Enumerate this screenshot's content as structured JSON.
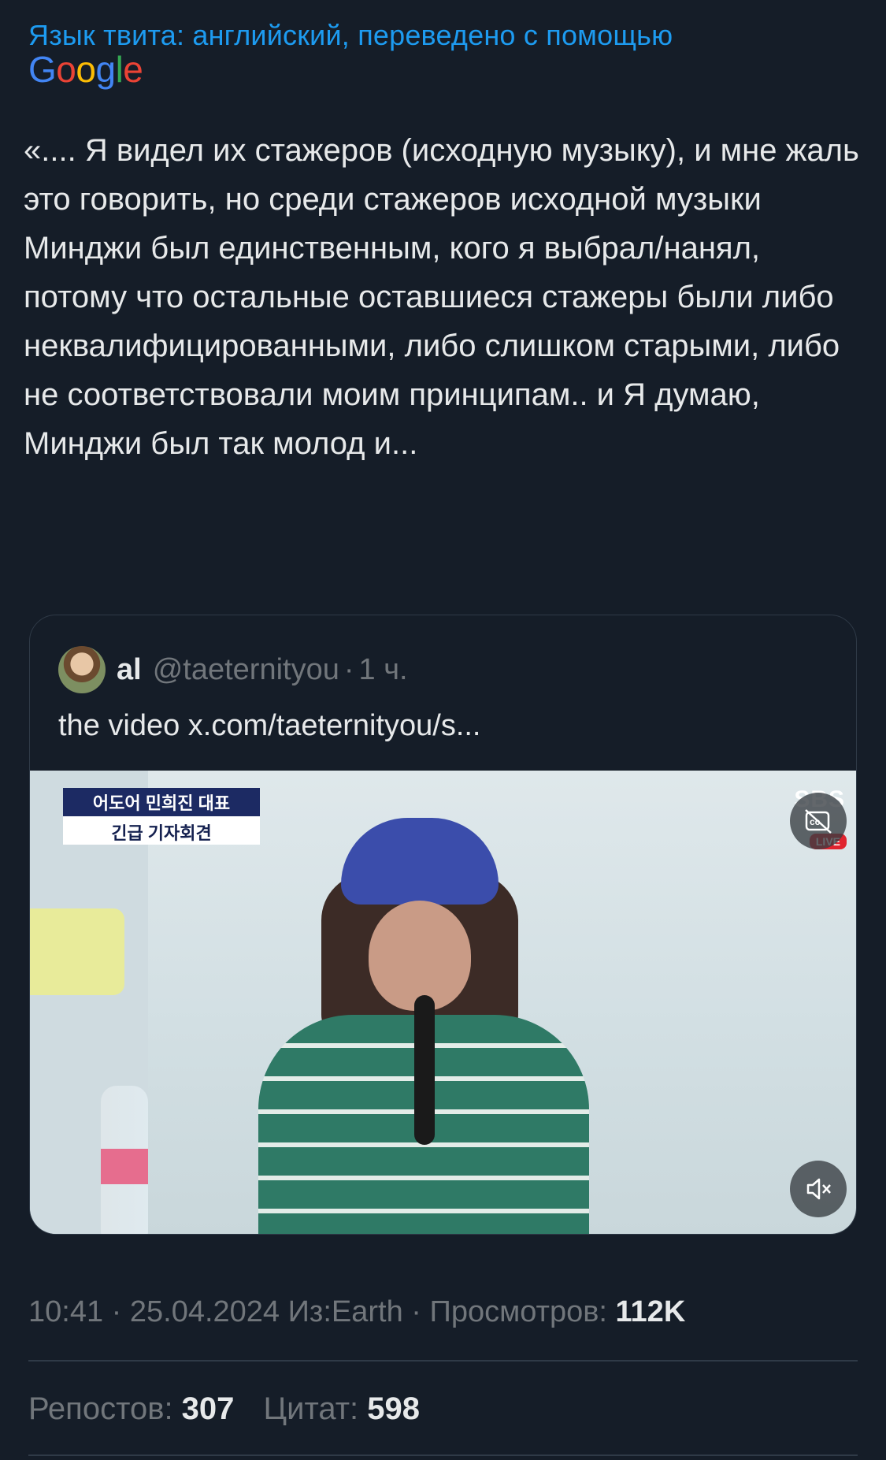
{
  "translation": {
    "label": "Язык твита: английский, переведено с помощью",
    "provider_letters": [
      "G",
      "o",
      "o",
      "g",
      "l",
      "e"
    ],
    "provider_colors": [
      "#4285f4",
      "#ea4335",
      "#fbbc05",
      "#4285f4",
      "#34a853",
      "#ea4335"
    ]
  },
  "tweet": {
    "text": "«.... Я видел их стажеров (исходную музыку), и мне жаль это говорить, но среди стажеров исходной музыки Минджи был единственным, кого я выбрал/нанял, потому что остальные оставшиеся стажеры были либо неквалифицированными, либо слишком старыми, либо не соответствовали моим принципам.. и Я думаю, Минджи был так молод и..."
  },
  "quote": {
    "name": "al",
    "handle": "@taeternityou",
    "separator": "·",
    "time": "1 ч.",
    "text": "the video x.com/taeternityou/s..."
  },
  "media": {
    "caption_line1": "어도어 민희진 대표",
    "caption_line2": "긴급 기자회견",
    "channel": "SBS",
    "live_label": "LIVE",
    "cc_icon": "closed-captions-off-icon",
    "mute_icon": "muted-speaker-icon"
  },
  "meta": {
    "time": "10:41",
    "sep1": " · ",
    "date": "25.04.2024",
    "source": " Из:Earth",
    "sep2": " · ",
    "views_label": "Просмотров: ",
    "views_value": "112K"
  },
  "stats": {
    "reposts_label": "Репостов: ",
    "reposts_value": "307",
    "quotes_label": "Цитат: ",
    "quotes_value": "598"
  },
  "colors": {
    "background": "#151d28",
    "link": "#1d9bf0",
    "text": "#e7e9ea",
    "muted": "#71767b",
    "border": "#2f3a47"
  }
}
